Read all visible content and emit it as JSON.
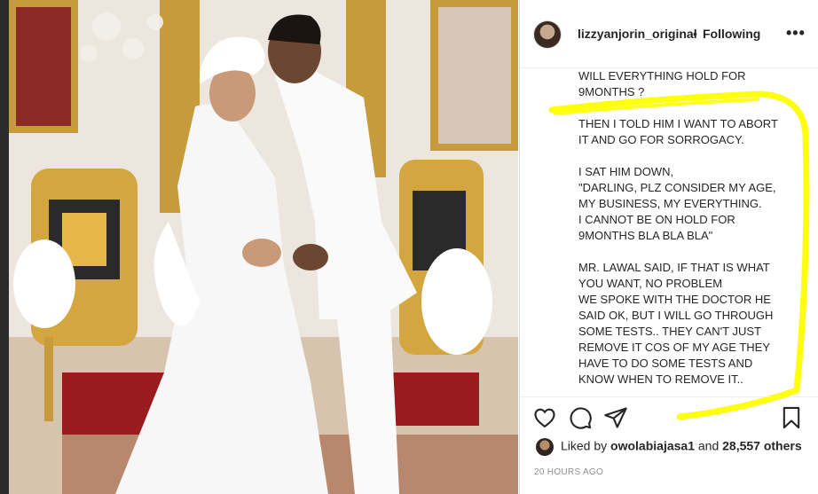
{
  "colors": {
    "highlight": "#ffff00",
    "text": "#262626",
    "muted": "#8e8e8e"
  },
  "post": {
    "username": "lizzyanjorin_original",
    "dot": "•",
    "follow_label": "Following",
    "more_label": "•••",
    "caption": "WILL EVERYTHING HOLD FOR\n9MONTHS ?\n\nTHEN I TOLD HIM I WANT TO ABORT\nIT AND GO FOR SORROGACY.\n\nI SAT HIM DOWN,\n\"DARLING, PLZ CONSIDER MY AGE,\nMY BUSINESS, MY EVERYTHING.\nI CANNOT BE ON HOLD FOR\n9MONTHS BLA BLA BLA\"\n\nMR. LAWAL SAID, IF THAT IS WHAT\nYOU WANT, NO PROBLEM\nWE SPOKE WITH THE DOCTOR HE\nSAID OK, BUT I WILL GO THROUGH\nSOME TESTS.. THEY CAN'T JUST\nREMOVE IT COS OF MY AGE THEY\nHAVE TO DO SOME TESTS AND\nKNOW WHEN TO REMOVE IT..",
    "likes": {
      "prefix": "Liked by ",
      "liker": "owolabiajasa1",
      "middle": " and ",
      "count": "28,557 others"
    },
    "time": "20 HOURS AGO"
  },
  "icons": {
    "like": "heart-icon",
    "comment": "comment-icon",
    "share": "paper-plane-icon",
    "save": "bookmark-icon",
    "more": "more-options-icon"
  }
}
